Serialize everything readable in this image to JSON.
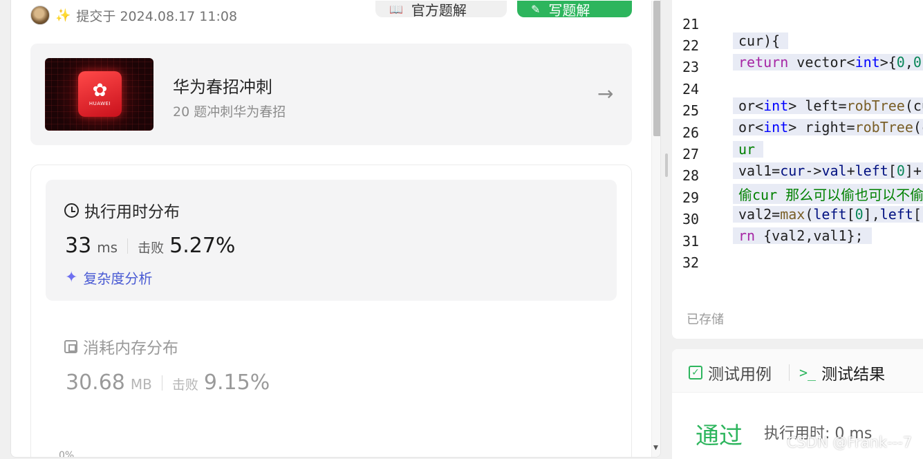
{
  "submission": {
    "sparkle": "✨",
    "submitted_at": "提交于 2024.08.17 11:08",
    "official_solution_label": "官方题解",
    "write_solution_label": "写题解"
  },
  "promo": {
    "title": "华为春招冲刺",
    "subtitle": "20 题冲刺华为春招",
    "logo_text": "HUAWEI"
  },
  "runtime": {
    "title": "执行用时分布",
    "value": "33",
    "unit": "ms",
    "beat_label": "击败",
    "beat_value": "5.27%",
    "complexity_link": "复杂度分析"
  },
  "memory": {
    "title": "消耗内存分布",
    "value": "30.68",
    "unit": "MB",
    "beat_label": "击败",
    "beat_value": "9.15%"
  },
  "chart_axis_label": "0%",
  "editor": {
    "saved_label": "已存储"
  },
  "test_panel": {
    "tab_cases": "测试用例",
    "tab_results": "测试结果",
    "status": "通过",
    "runtime": "执行用时: 0 ms"
  },
  "watermark": "CSDN @Frank---7",
  "colors": {
    "accent_green": "#2db55d",
    "link_blue": "#4a5bd4"
  }
}
